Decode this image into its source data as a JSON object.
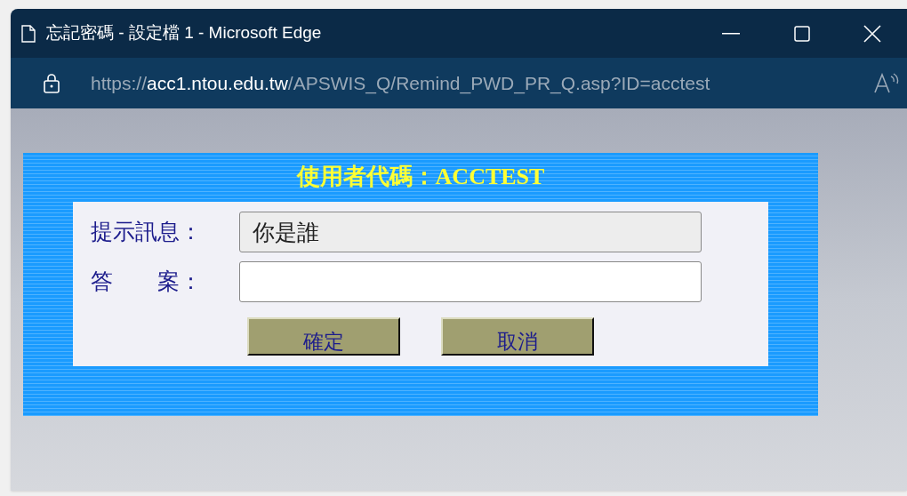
{
  "window": {
    "title": "忘記密碼 - 設定檔 1 - Microsoft Edge"
  },
  "address_bar": {
    "url_parts": [
      {
        "text": "https://",
        "kind": "dim"
      },
      {
        "text": "acc1.ntou.edu.tw",
        "kind": "host"
      },
      {
        "text": "/APSWIS_Q/Remind_PWD_PR_Q.asp?ID=acctest",
        "kind": "dim"
      }
    ]
  },
  "form": {
    "heading": "使用者代碼：ACCTEST",
    "fields": [
      {
        "label": "提示訊息：",
        "value": "你是誰",
        "disabled": true
      },
      {
        "label": "答　　案：",
        "disabled": false
      }
    ],
    "buttons": [
      "確定",
      "取消"
    ]
  }
}
